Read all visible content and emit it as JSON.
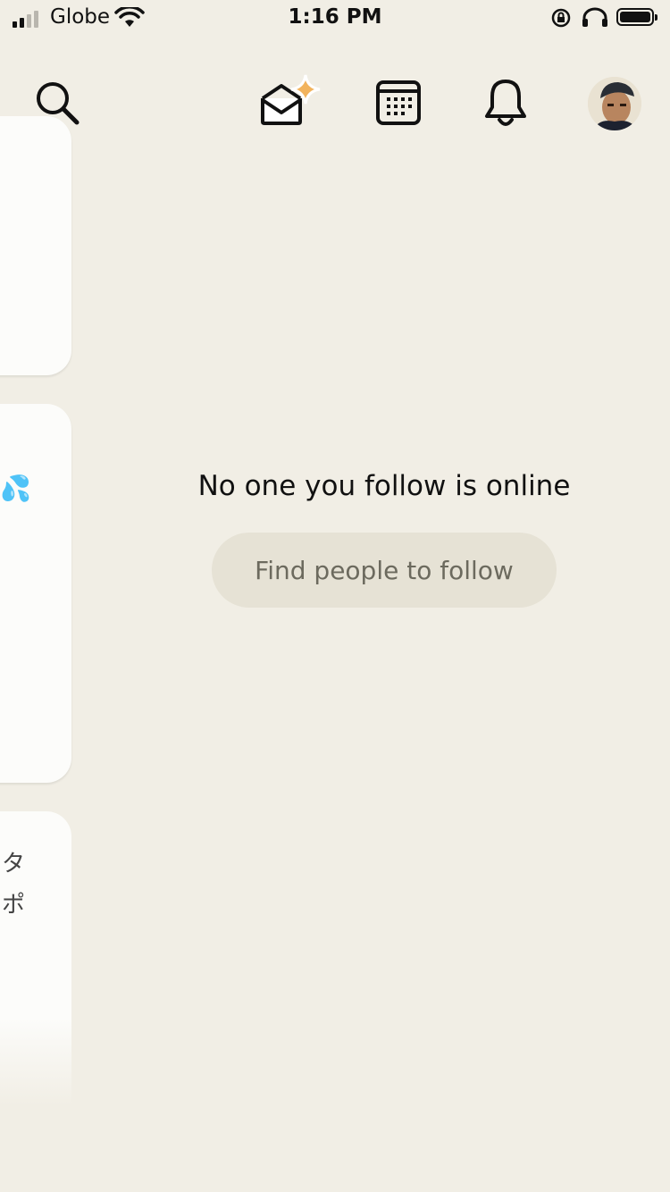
{
  "status_bar": {
    "carrier": "Globe",
    "time": "1:16 PM"
  },
  "toolbar": {
    "icons": [
      "search-icon",
      "invite-envelope-icon",
      "calendar-icon",
      "bell-icon",
      "avatar"
    ]
  },
  "cards": {
    "card2_emoji": "💦",
    "card3_text_line1": "タ",
    "card3_text_line2": "ポ"
  },
  "main": {
    "empty_message": "No one you follow is online",
    "find_button_label": "Find people to follow"
  },
  "colors": {
    "background": "#f1eee5",
    "button_bg": "#e6e2d5",
    "sparkle": "#f2b35c"
  }
}
